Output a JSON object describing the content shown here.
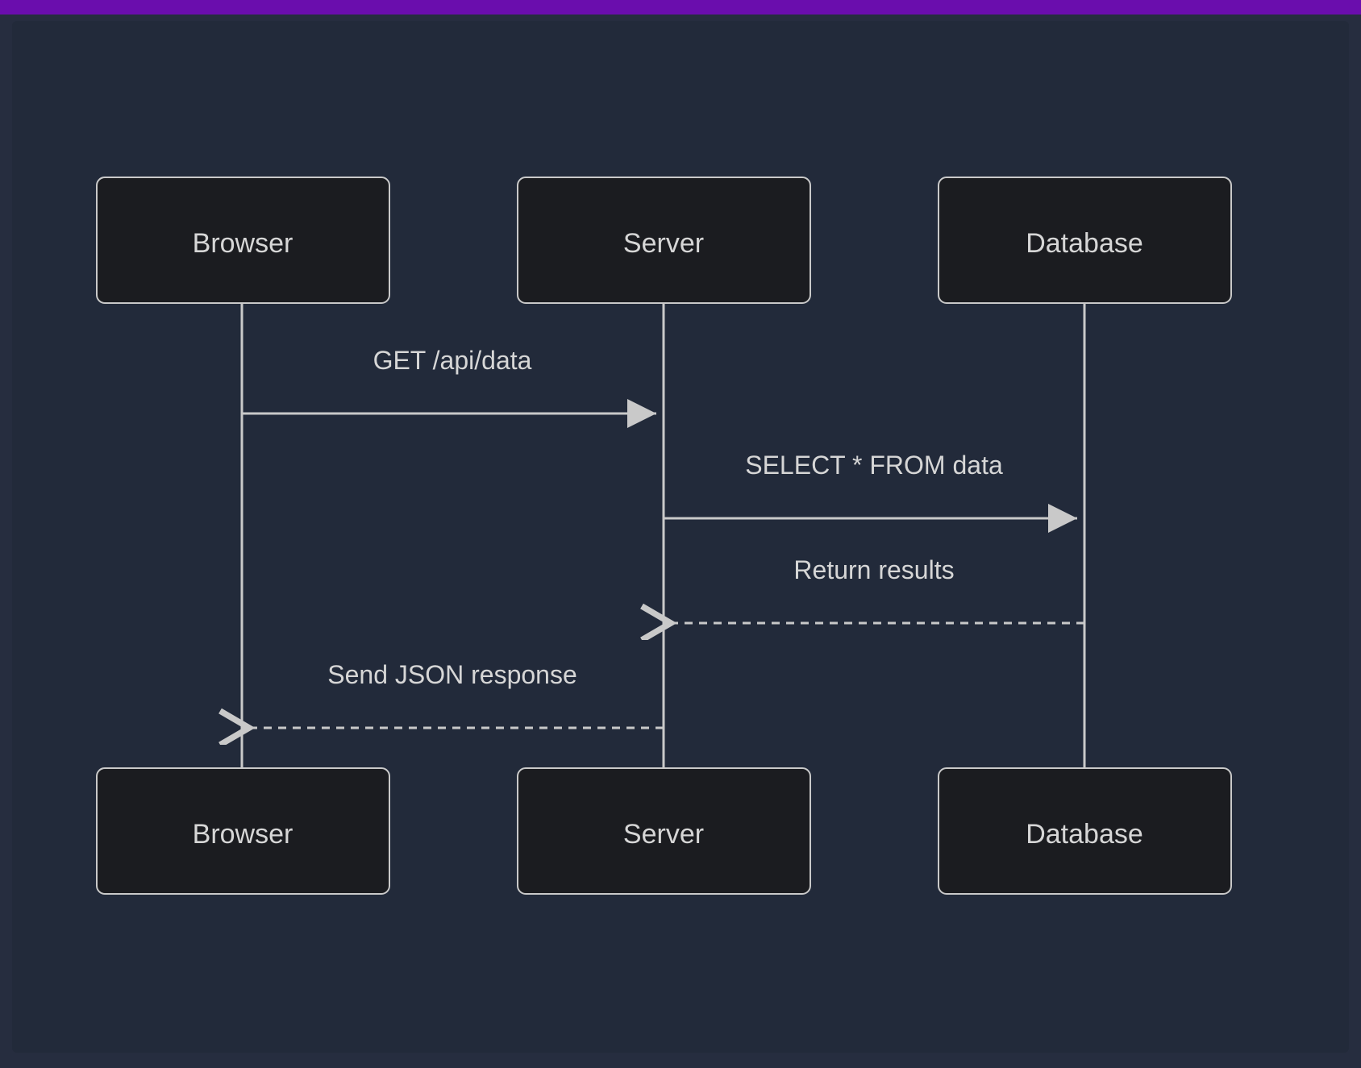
{
  "colors": {
    "topbar": "#6a0dad",
    "canvas_bg": "#262d3f",
    "panel_bg": "#222a3a",
    "box_fill": "#1b1c20",
    "stroke": "#c9c9c9",
    "text": "#d6d6d6"
  },
  "diagram": {
    "type": "sequence",
    "actors": [
      {
        "id": "browser",
        "label": "Browser"
      },
      {
        "id": "server",
        "label": "Server"
      },
      {
        "id": "database",
        "label": "Database"
      }
    ],
    "messages": [
      {
        "from": "browser",
        "to": "server",
        "text": "GET /api/data",
        "style": "solid",
        "arrow": "closed"
      },
      {
        "from": "server",
        "to": "database",
        "text": "SELECT * FROM data",
        "style": "solid",
        "arrow": "closed"
      },
      {
        "from": "database",
        "to": "server",
        "text": "Return results",
        "style": "dashed",
        "arrow": "open"
      },
      {
        "from": "server",
        "to": "browser",
        "text": "Send JSON response",
        "style": "dashed",
        "arrow": "open"
      }
    ]
  }
}
